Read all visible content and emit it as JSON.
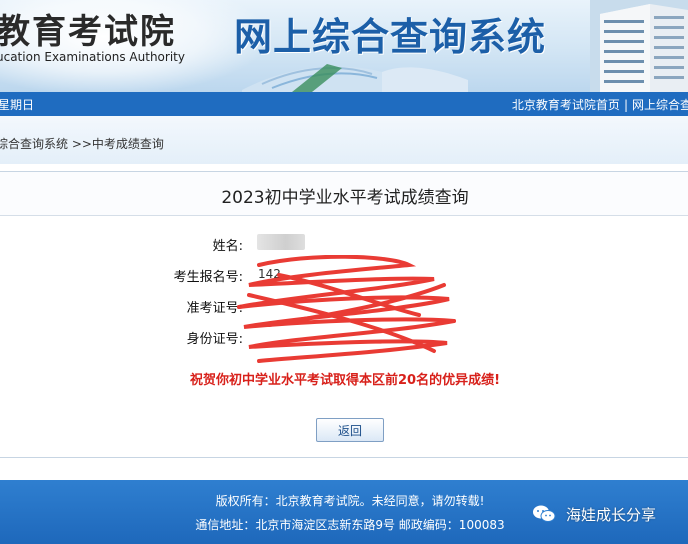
{
  "banner": {
    "org_name_cn": "教育考试院",
    "org_name_en": "ucation Examinations Authority",
    "system_title": "网上综合查询系统"
  },
  "nav": {
    "weekday": "星期日",
    "home_link": "北京教育考试院首页",
    "separator": "|",
    "system_link": "网上综合查"
  },
  "breadcrumb": {
    "text": "综合查询系统 >>中考成绩查询"
  },
  "card": {
    "title": "2023初中学业水平考试成绩查询",
    "fields": [
      {
        "label": "姓名:",
        "value": ""
      },
      {
        "label": "考生报名号:",
        "value": "142"
      },
      {
        "label": "准考证号:",
        "value": ""
      },
      {
        "label": "身份证号:",
        "value": ""
      }
    ],
    "congrats": "祝贺你初中学业水平考试取得本区前20名的优异成绩!",
    "back_button": "返回",
    "redaction_color": "#e8312a"
  },
  "footer": {
    "copyright": "版权所有：北京教育考试院。未经同意，请勿转载!",
    "address": "通信地址：北京市海淀区志新东路9号 邮政编码：100083",
    "watermark": "海娃成长分享"
  },
  "colors": {
    "nav_blue": "#1f6cc0",
    "title_blue": "#1c5fa8",
    "congrats_red": "#d8211b",
    "footer_blue": "#2f7fd0"
  }
}
